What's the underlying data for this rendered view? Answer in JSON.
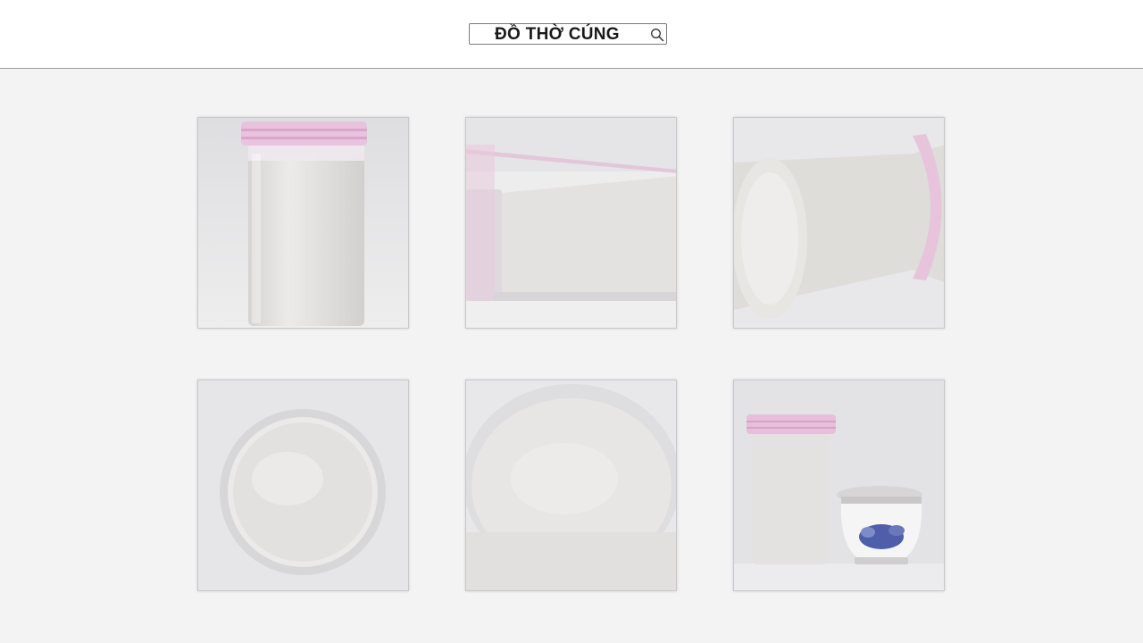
{
  "search": {
    "query": "ĐỒ THỜ CÚNG",
    "icon": "search-icon"
  },
  "gallery": {
    "items": [
      {
        "name": "jar-upright"
      },
      {
        "name": "jar-side-left"
      },
      {
        "name": "jar-side-bottom"
      },
      {
        "name": "jar-top-view"
      },
      {
        "name": "jar-open-angle"
      },
      {
        "name": "jar-with-incense-bowl"
      }
    ]
  },
  "colors": {
    "lid_pink": "#e8b9d6",
    "sand": "#e6e4e2",
    "tile_bg": "#dcdcdd",
    "bowl_blue": "#4f5eaa"
  }
}
